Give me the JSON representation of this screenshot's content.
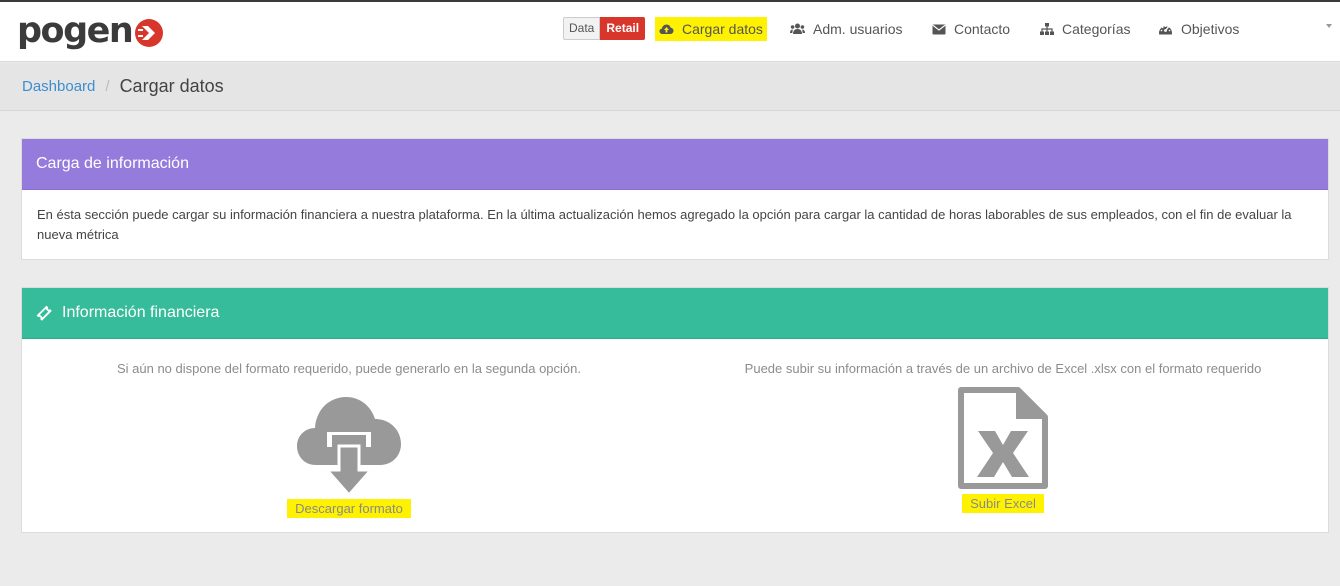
{
  "app": {
    "logo_text": "pogen",
    "brand_toggle": {
      "left": "Data",
      "right": "Retail"
    }
  },
  "nav": {
    "items": [
      {
        "label": "Cargar datos",
        "icon": "cloud-upload-icon",
        "highlighted": true
      },
      {
        "label": "Adm. usuarios",
        "icon": "users-icon"
      },
      {
        "label": "Contacto",
        "icon": "envelope-icon"
      },
      {
        "label": "Categorías",
        "icon": "sitemap-icon"
      },
      {
        "label": "Objetivos",
        "icon": "dashboard-gauge-icon"
      }
    ]
  },
  "breadcrumb": {
    "root": "Dashboard",
    "separator": "/",
    "current": "Cargar datos"
  },
  "panel_info": {
    "title": "Carga de información",
    "body": "En ésta sección puede cargar su información financiera a nuestra plataforma. En la última actualización hemos agregado la opción para cargar la cantidad de horas laborables de sus empleados, con el fin de evaluar la nueva métrica"
  },
  "panel_finance": {
    "title": "Información financiera",
    "title_icon": "ticket-icon",
    "left": {
      "description": "Si aún no dispone del formato requerido, puede generarlo en la segunda opción.",
      "icon": "cloud-download-icon",
      "link": "Descargar formato"
    },
    "right": {
      "description": "Puede subir su información a través de un archivo de Excel .xlsx con el formato requerido",
      "icon": "excel-file-icon",
      "link": "Subir Excel"
    }
  },
  "colors": {
    "brand_red": "#d9362b",
    "purple_header": "#957bdc",
    "green_header": "#36bc9b",
    "highlight": "#fff200",
    "link_blue": "#3b8ed1"
  }
}
